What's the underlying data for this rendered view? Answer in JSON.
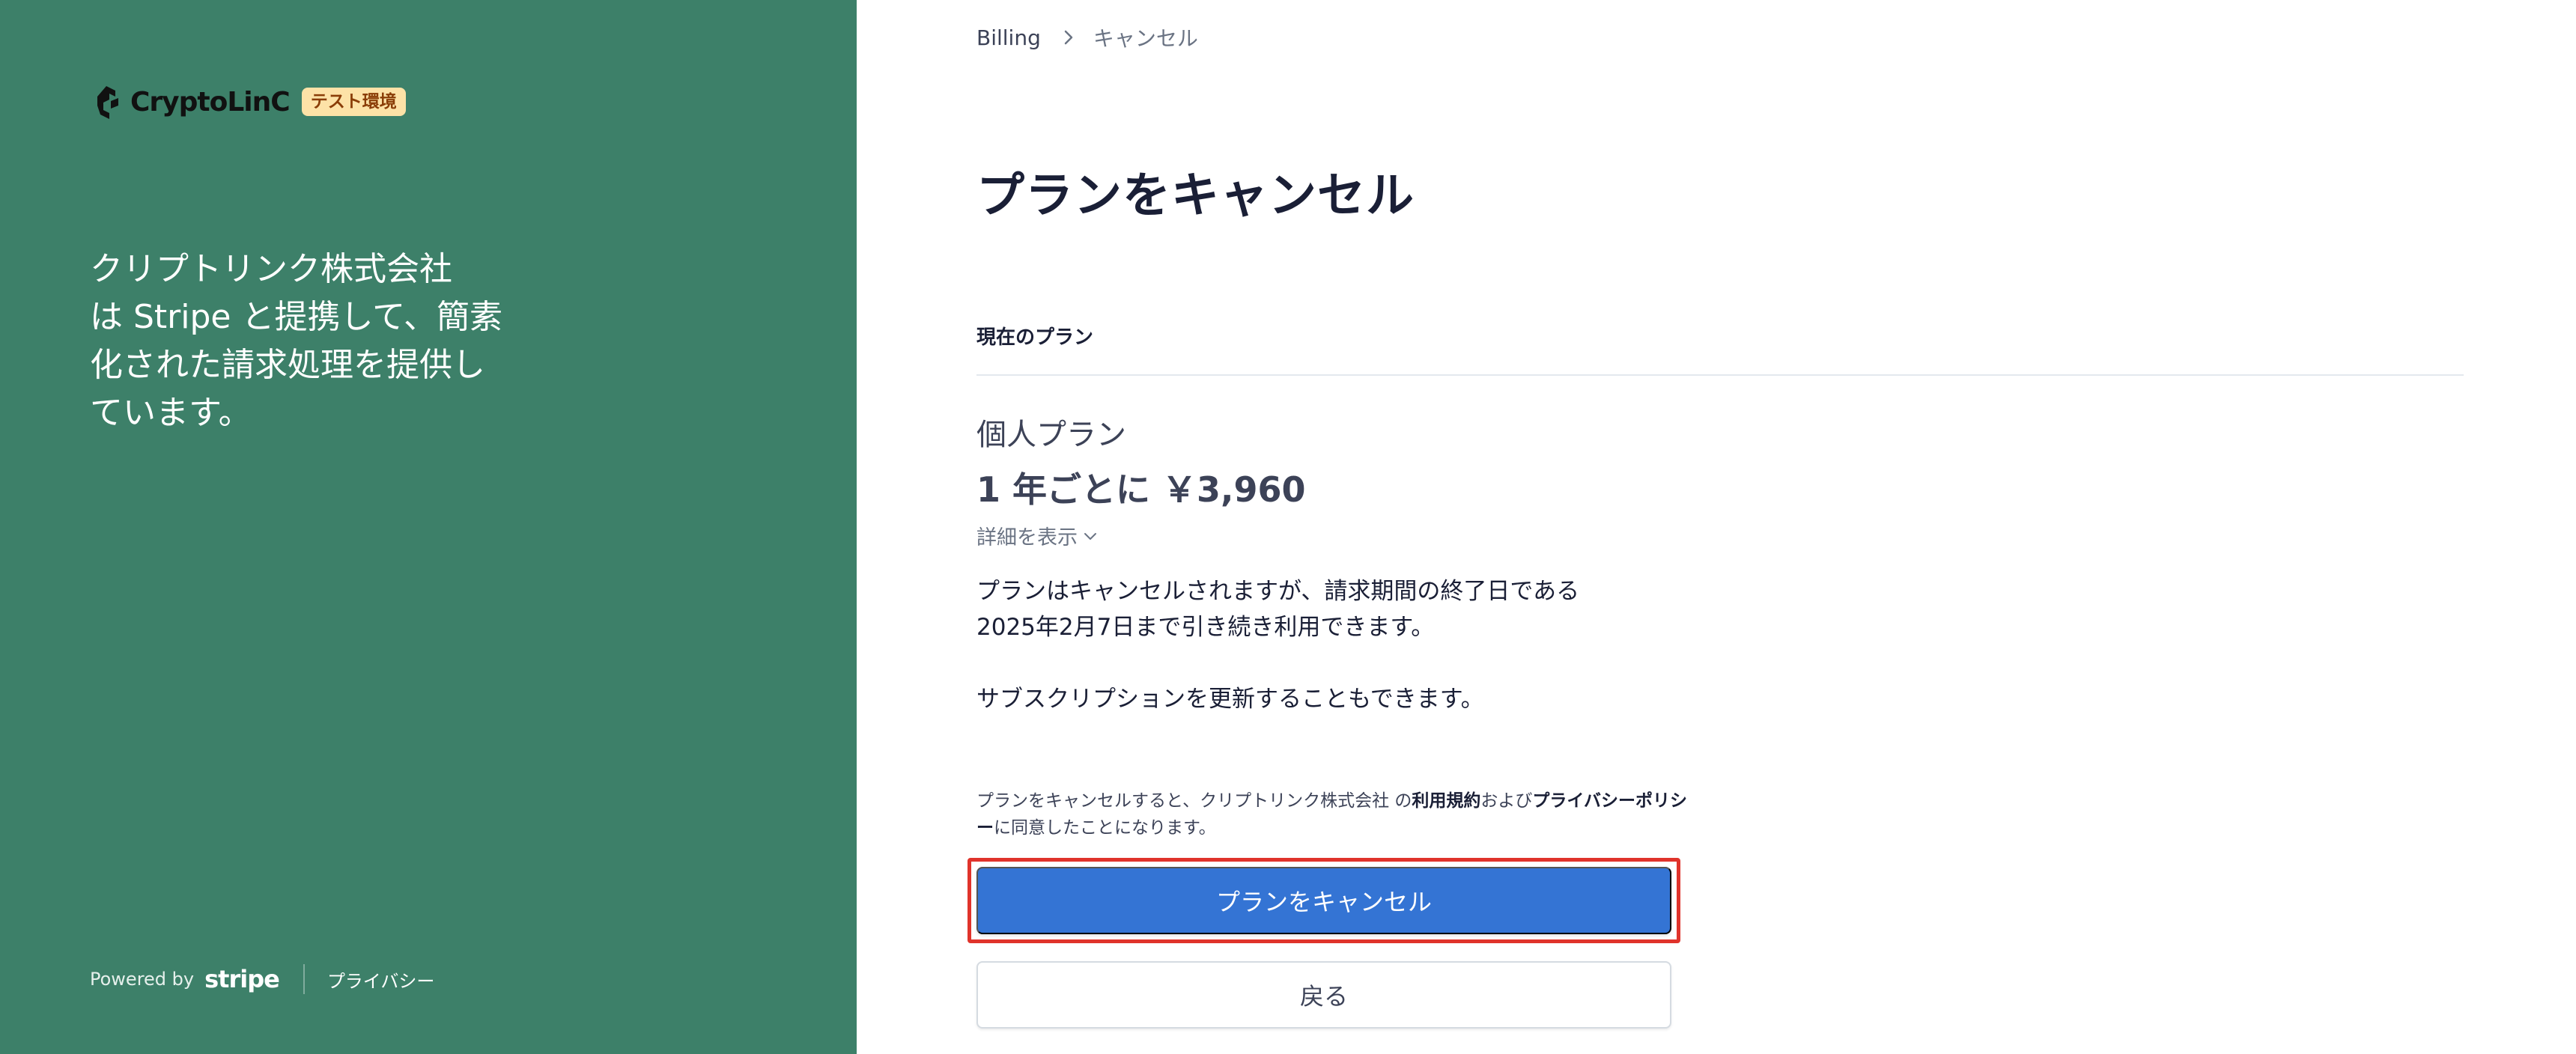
{
  "left_panel": {
    "background_color": "#3d8069",
    "brand": {
      "logo_text": "CryptoLinC",
      "test_badge": "テスト環境"
    },
    "headline_lines": [
      "クリプトリンク株式会社",
      "は Stripe と提携して、簡素",
      "化された請求処理を提供し",
      "ています。"
    ],
    "footer": {
      "powered_by": "Powered by",
      "stripe_word": "stripe",
      "privacy_link": "プライバシー"
    }
  },
  "right_panel": {
    "breadcrumb": {
      "billing": "Billing",
      "current": "キャンセル"
    },
    "page_title": "プランをキャンセル",
    "current_plan_label": "現在のプラン",
    "plan": {
      "name": "個人プラン",
      "price": "1 年ごとに ￥3,960",
      "details_toggle": "詳細を表示"
    },
    "notice": {
      "line1": "プランはキャンセルされますが、請求期間の終了日である",
      "line2": "2025年2月7日まで引き続き利用できます。",
      "renew": "サブスクリプションを更新することもできます。"
    },
    "terms": {
      "prefix": "プランをキャンセルすると、クリプトリンク株式会社 の",
      "terms_link": "利用規約",
      "and": "および",
      "privacy_link": "プライバシーポリシー",
      "suffix": "に同意したことになります。"
    },
    "buttons": {
      "cancel_plan": "プランをキャンセル",
      "back": "戻る"
    },
    "accent_color": "#3474d4",
    "highlight_color": "#e0332b"
  }
}
